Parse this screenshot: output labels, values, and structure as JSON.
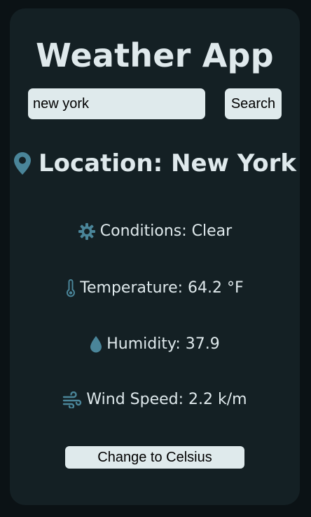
{
  "app": {
    "title": "Weather App"
  },
  "search": {
    "value": "new york",
    "button_label": "Search"
  },
  "location": {
    "text": "Location: New York"
  },
  "weather": {
    "conditions": "Conditions: Clear",
    "temperature": "Temperature: 64.2 °F",
    "humidity": "Humidity: 37.9",
    "wind_speed": "Wind Speed: 2.2 k/m"
  },
  "units": {
    "toggle_label": "Change to Celsius"
  },
  "icons": {
    "location": "map-pin-icon",
    "conditions": "sun-icon",
    "temperature": "thermometer-icon",
    "humidity": "water-drop-icon",
    "wind": "wind-icon"
  },
  "colors": {
    "background": "#0b1215",
    "card": "#142024",
    "text": "#dfe9ec",
    "accent": "#4a8599",
    "control": "#dfeaec"
  }
}
